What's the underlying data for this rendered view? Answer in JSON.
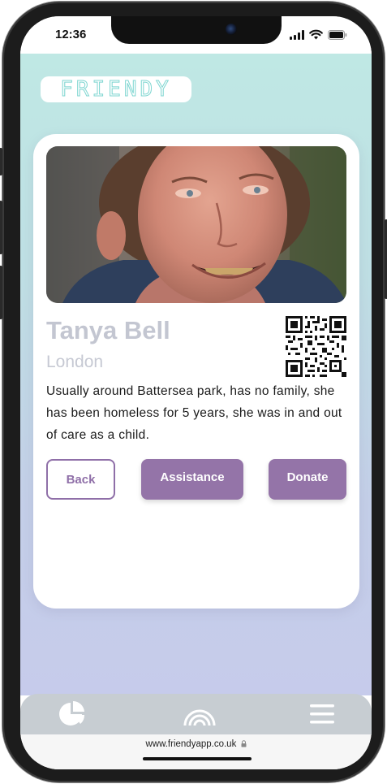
{
  "status": {
    "time": "12:36"
  },
  "app": {
    "logo_text": "FRIENDY"
  },
  "profile": {
    "name": "Tanya Bell",
    "location": "London",
    "bio": "Usually around Battersea park, has no family, she has been homeless for 5 years, she was in and out of care as a child."
  },
  "actions": {
    "back_label": "Back",
    "assistance_label": "Assistance",
    "donate_label": "Donate"
  },
  "tabbar": {
    "items": [
      {
        "icon": "pie-chart-icon"
      },
      {
        "icon": "rainbow-icon"
      },
      {
        "icon": "menu-icon"
      }
    ]
  },
  "browser": {
    "url": "www.friendyapp.co.uk"
  },
  "colors": {
    "accent": "#9474a8",
    "background_top": "#bfe8e4",
    "background_bottom": "#c6cbeb",
    "logo_outline": "#7fd6d1",
    "name_text": "#c3c6d1"
  }
}
